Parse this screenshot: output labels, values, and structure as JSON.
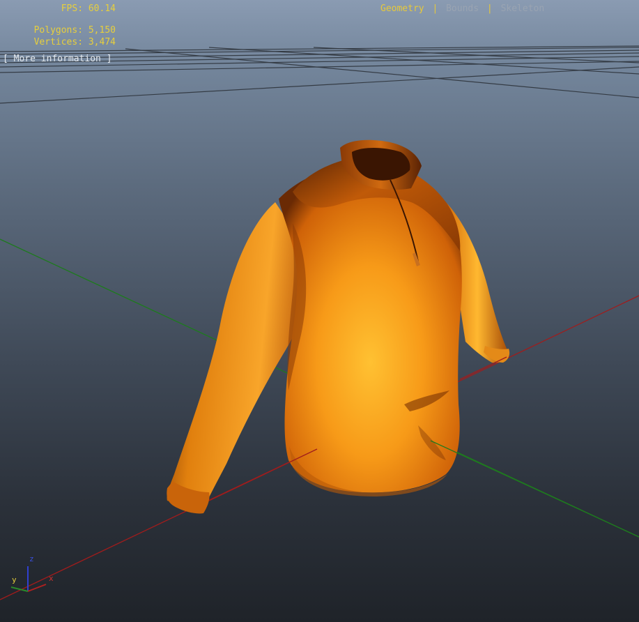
{
  "stats": {
    "fps": "FPS: 60.14",
    "polygons": "Polygons: 5,150",
    "vertices": "Vertices: 3,474",
    "more_info": "[ More information ]"
  },
  "view_tabs": [
    {
      "label": "Geometry",
      "active": true
    },
    {
      "label": "Bounds",
      "active": false
    },
    {
      "label": "Skeleton",
      "active": false
    }
  ],
  "tab_separator": "|",
  "axis_gizmo": {
    "x_label": "x",
    "y_label": "y",
    "z_label": "z"
  },
  "colors": {
    "stats_text": "#e7cf3c",
    "active_tab": "#e7c93a",
    "x_axis": "#b02020",
    "y_axis": "#2a8a2a",
    "z_axis": "#3040d0",
    "model_base": "#e8760a",
    "model_highlight": "#ffbf30",
    "model_shadow": "#4a1e02"
  },
  "model": {
    "icon": "hoodie-3d-model"
  }
}
